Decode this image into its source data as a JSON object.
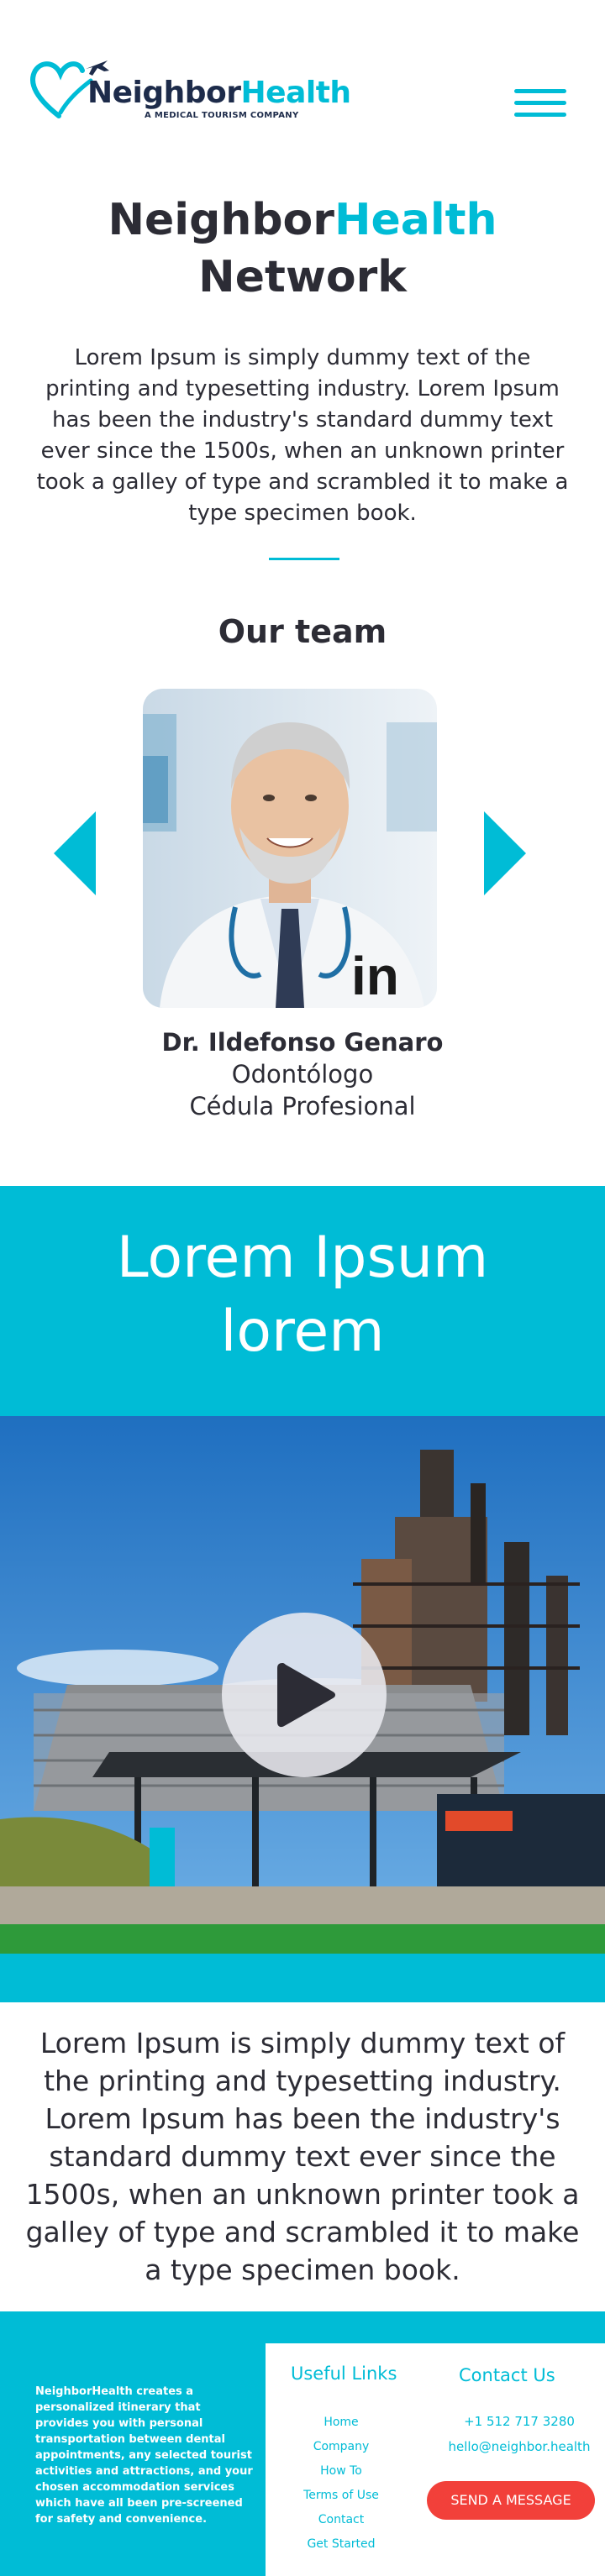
{
  "header": {
    "logo_name_part1": "Neighbor",
    "logo_name_part2": "Health",
    "logo_tagline": "A MEDICAL TOURISM COMPANY",
    "menu_icon": "hamburger-menu-icon"
  },
  "intro": {
    "title_part1": "Neighbor",
    "title_part2": "Health",
    "title_line2": "Network",
    "text": "Lorem Ipsum is simply dummy text of the printing and typesetting industry. Lorem Ipsum has been the industry's standard dummy text ever since the 1500s, when an unknown printer took a galley of type and scrambled it to make a type specimen book."
  },
  "team": {
    "title": "Our team",
    "member": {
      "name": "Dr. Ildefonso Genaro",
      "role": "Odontólogo",
      "license": "Cédula Profesional",
      "social_icon": "linkedin-icon",
      "social_text": "in"
    }
  },
  "banner": {
    "title_line1": "Lorem Ipsum",
    "title_line2": "lorem",
    "video_icon": "play-icon"
  },
  "lower": {
    "text": "Lorem Ipsum is simply dummy text of the printing and typesetting industry. Lorem Ipsum has been the industry's standard dummy text ever since the 1500s, when an unknown printer took a galley of type and scrambled it to make a type specimen book."
  },
  "footer": {
    "about": "NeighborHealth creates a personalized itinerary that provides you with personal transportation between dental appointments, any selected tourist activities and attractions, and your chosen accommodation services which have all been pre-screened for safety and convenience.",
    "links_title": "Useful Links",
    "links": [
      "Home",
      "Company",
      "How To",
      "Terms of Use",
      "Contact",
      "Get Started"
    ],
    "contact_title": "Contact Us",
    "phone": "+1 512 717 3280",
    "email": "hello@neighbor.health",
    "send_button": "SEND A MESSAGE"
  },
  "colors": {
    "accent": "#00bcd6",
    "text": "#2c2c35",
    "navy": "#1d2b4a",
    "button": "#f2403a"
  }
}
